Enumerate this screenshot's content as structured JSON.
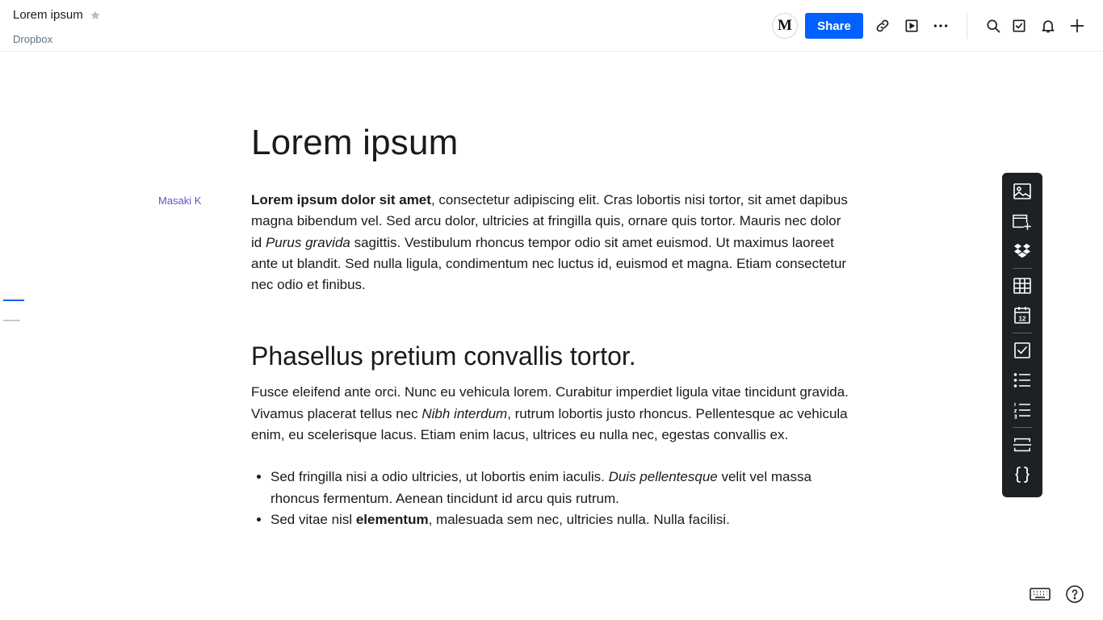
{
  "header": {
    "doc_title": "Lorem ipsum",
    "breadcrumb": "Dropbox",
    "avatar_initial": "M",
    "share_label": "Share",
    "icons": [
      "star-icon",
      "link-icon",
      "present-icon",
      "more-icon",
      "search-icon",
      "tasks-icon",
      "bell-icon",
      "plus-icon"
    ]
  },
  "document": {
    "title": "Lorem ipsum",
    "author": "Masaki K",
    "p1": {
      "bold_lead": "Lorem ipsum dolor sit amet",
      "text_a": ", consectetur adipiscing elit. Cras lobortis nisi tortor, sit amet dapibus magna bibendum vel. Sed arcu dolor, ultricies at fringilla quis, ornare quis tortor. Mauris nec dolor id ",
      "italic": "Purus gravida",
      "text_b": " sagittis. Vestibulum rhoncus tempor odio sit amet euismod. Ut maximus laoreet ante ut blandit. Sed nulla ligula, condimentum nec luctus id, euismod et magna. Etiam consectetur nec odio et finibus."
    },
    "heading2": "Phasellus pretium convallis tortor.",
    "p2": {
      "text_a": "Fusce eleifend ante orci. Nunc eu vehicula lorem. Curabitur imperdiet ligula vitae tincidunt gravida. Vivamus placerat tellus nec ",
      "italic": "Nibh interdum",
      "text_b": ", rutrum lobortis justo rhoncus. Pellentesque ac vehicula enim, eu scelerisque lacus. Etiam enim lacus, ultrices eu nulla nec, egestas convallis ex."
    },
    "bullets": [
      {
        "text_a": "Sed fringilla nisi a odio ultricies, ut lobortis enim iaculis. ",
        "italic": "Duis pellentesque",
        "text_b": " velit vel massa rhoncus fermentum. Aenean tincidunt id arcu quis rutrum."
      },
      {
        "text_a": "Sed vitae nisl ",
        "bold": "elementum",
        "text_b": ", malesuada sem nec, ultricies nulla. Nulla facilisi."
      }
    ]
  },
  "toolbar": {
    "items": [
      "image-icon",
      "embed-icon",
      "dropbox-icon",
      "table-icon",
      "calendar-icon",
      "checkbox-icon",
      "bullet-list-icon",
      "numbered-list-icon",
      "divider-icon",
      "code-icon"
    ],
    "calendar_day": "12"
  },
  "colors": {
    "accent": "#0061fe",
    "toolbar_bg": "#1e2124",
    "author": "#5a56c6"
  }
}
